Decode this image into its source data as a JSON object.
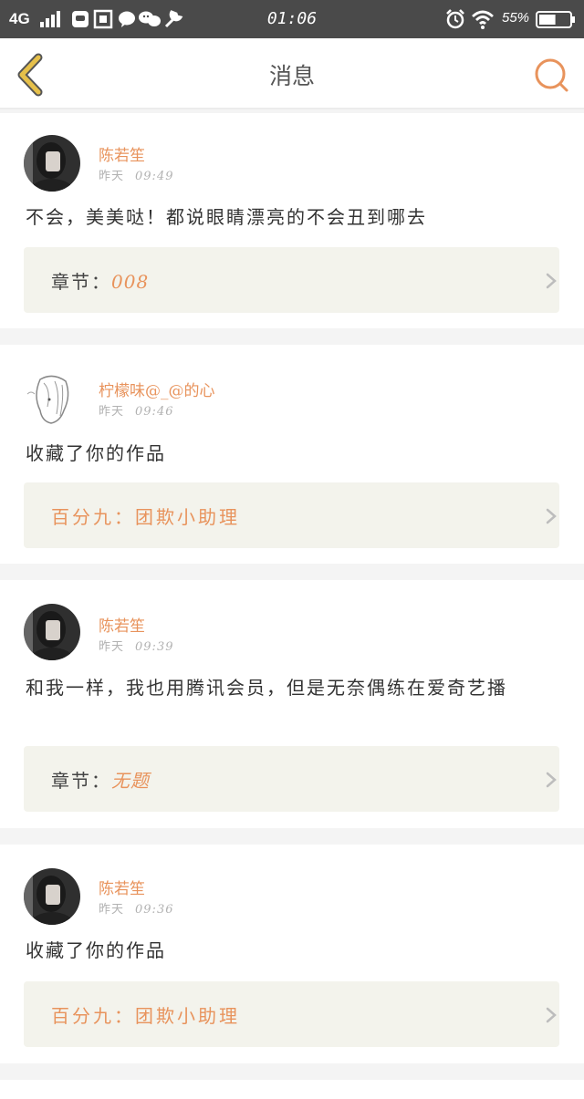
{
  "status_bar": {
    "network": "4G",
    "time": "01:06",
    "battery_percent": "55%",
    "battery_level": 0.55,
    "icons": [
      "signal-icon",
      "app-icons",
      "alarm-icon",
      "wifi-icon",
      "battery-icon"
    ]
  },
  "nav": {
    "title": "消息",
    "back_icon": "back-arrow-icon",
    "search_icon": "search-icon"
  },
  "colors": {
    "accent": "#e8935c",
    "back_arrow": "#e6c04a",
    "status_bar": "#4a4a4a",
    "link_box": "#f3f3ec"
  },
  "messages": [
    {
      "user": "陈若笙",
      "day": "昨天",
      "time": "09:49",
      "text": "不会，美美哒！都说眼睛漂亮的不会丑到哪去",
      "link_label": "章节：",
      "link_value": "008"
    },
    {
      "user": "柠檬味@_@的心",
      "day": "昨天",
      "time": "09:46",
      "text": "收藏了你的作品",
      "link_text": "百分九：团欺小助理"
    },
    {
      "user": "陈若笙",
      "day": "昨天",
      "time": "09:39",
      "text": "和我一样，我也用腾讯会员，但是无奈偶练在爱奇艺播",
      "link_label": "章节：",
      "link_value": "无题"
    },
    {
      "user": "陈若笙",
      "day": "昨天",
      "time": "09:36",
      "text": "收藏了你的作品",
      "link_text": "百分九：团欺小助理"
    }
  ]
}
